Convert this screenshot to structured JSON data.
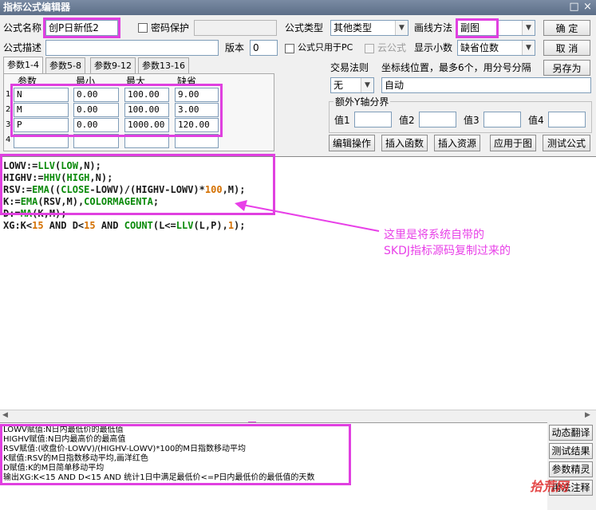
{
  "window": {
    "title": "指标公式编辑器"
  },
  "row1": {
    "name_label": "公式名称",
    "name_value": "创P日新低2",
    "pwd_label": "密码保护",
    "type_label": "公式类型",
    "type_value": "其他类型",
    "draw_label": "画线方法",
    "draw_value": "副图"
  },
  "row2": {
    "desc_label": "公式描述",
    "version_label": "版本",
    "version_value": "0",
    "pc_only_label": "公式只用于PC",
    "cloud_label": "云公式",
    "decimals_label": "显示小数",
    "decimals_value": "缺省位数"
  },
  "buttons": {
    "ok": "确  定",
    "cancel": "取  消",
    "save_as": "另存为",
    "edit_ops": "编辑操作",
    "insert_fn": "插入函数",
    "insert_res": "插入资源",
    "apply_chart": "应用于图",
    "test_formula": "测试公式"
  },
  "tabs": [
    "参数1-4",
    "参数5-8",
    "参数9-12",
    "参数13-16"
  ],
  "params": {
    "headers": [
      "参数",
      "最小",
      "最大",
      "缺省"
    ],
    "rows": [
      {
        "idx": "1",
        "name": "N",
        "min": "0.00",
        "max": "100.00",
        "def": "9.00"
      },
      {
        "idx": "2",
        "name": "M",
        "min": "0.00",
        "max": "100.00",
        "def": "3.00"
      },
      {
        "idx": "3",
        "name": "P",
        "min": "0.00",
        "max": "1000.00",
        "def": "120.00"
      },
      {
        "idx": "4",
        "name": "",
        "min": "",
        "max": "",
        "def": ""
      }
    ]
  },
  "trade": {
    "rule_label": "交易法则",
    "rule_value": "无",
    "axis_label": "坐标线位置，最多6个，用分号分隔",
    "axis_value": "自动"
  },
  "yaxis": {
    "group_label": "额外Y轴分界",
    "v1": "值1",
    "v2": "值2",
    "v3": "值3",
    "v4": "值4"
  },
  "code": {
    "lines": [
      [
        [
          "LOWV:=",
          "var"
        ],
        [
          "LLV",
          "fn"
        ],
        [
          "(",
          "op"
        ],
        [
          "LOW",
          "fn"
        ],
        [
          ",N);",
          "op"
        ]
      ],
      [
        [
          "HIGHV:=",
          "var"
        ],
        [
          "HHV",
          "fn"
        ],
        [
          "(",
          "op"
        ],
        [
          "HIGH",
          "fn"
        ],
        [
          ",N);",
          "op"
        ]
      ],
      [
        [
          "RSV:=",
          "var"
        ],
        [
          "EMA",
          "fn"
        ],
        [
          "((",
          "op"
        ],
        [
          "CLOSE",
          "fn"
        ],
        [
          "-LOWV)/(HIGHV-LOWV)*",
          "op"
        ],
        [
          "100",
          "num"
        ],
        [
          ",M);",
          "op"
        ]
      ],
      [
        [
          "K:=",
          "var"
        ],
        [
          "EMA",
          "fn"
        ],
        [
          "(RSV,M),",
          "op"
        ],
        [
          "COLORMAGENTA",
          "col"
        ],
        [
          ";",
          "op"
        ]
      ],
      [
        [
          "D:=",
          "var"
        ],
        [
          "MA",
          "fn"
        ],
        [
          "(K,M);",
          "op"
        ]
      ],
      [
        [
          "XG:K<",
          "var"
        ],
        [
          "15",
          "num"
        ],
        [
          " AND D<",
          "op"
        ],
        [
          "15",
          "num"
        ],
        [
          " AND ",
          "op"
        ],
        [
          "COUNT",
          "fn"
        ],
        [
          "(L<=",
          "op"
        ],
        [
          "LLV",
          "fn"
        ],
        [
          "(L,P),",
          "op"
        ],
        [
          "1",
          "num"
        ],
        [
          ");",
          "op"
        ]
      ]
    ],
    "line_texts": [
      "LOWV:=LLV(LOW,N);",
      "HIGHV:=HHV(HIGH,N);",
      "RSV:=EMA((CLOSE-LOWV)/(HIGHV-LOWV)*100,M);",
      "K:=EMA(RSV,M),COLORMAGENTA;",
      "D:=MA(K,M);",
      "XG:K<15 AND D<15 AND COUNT(L<=LLV(L,P),1);"
    ]
  },
  "annotation": {
    "line1": "这里是将系统自带的",
    "line2": "SKDJ指标源码复制过来的",
    "color": "#e840e8"
  },
  "output": {
    "lines": [
      "LOWV赋值:N日内最低价的最低值",
      "HIGHV赋值:N日内最高价的最高值",
      "RSV赋值:(收盘价-LOWV)/(HIGHV-LOWV)*100的M日指数移动平均",
      "K赋值:RSV的M日指数移动平均,画洋红色",
      "D赋值:K的M日简单移动平均",
      "输出XG:K<15 AND D<15 AND 统计1日中满足最低价<=P日内最低价的最低值的天数"
    ]
  },
  "side_buttons": [
    "动态翻译",
    "测试结果",
    "参数精灵",
    "用法注释"
  ],
  "watermark": "拾荒网",
  "colors": {
    "highlight": "#e040e0",
    "titlebar": "#6a7c96"
  }
}
